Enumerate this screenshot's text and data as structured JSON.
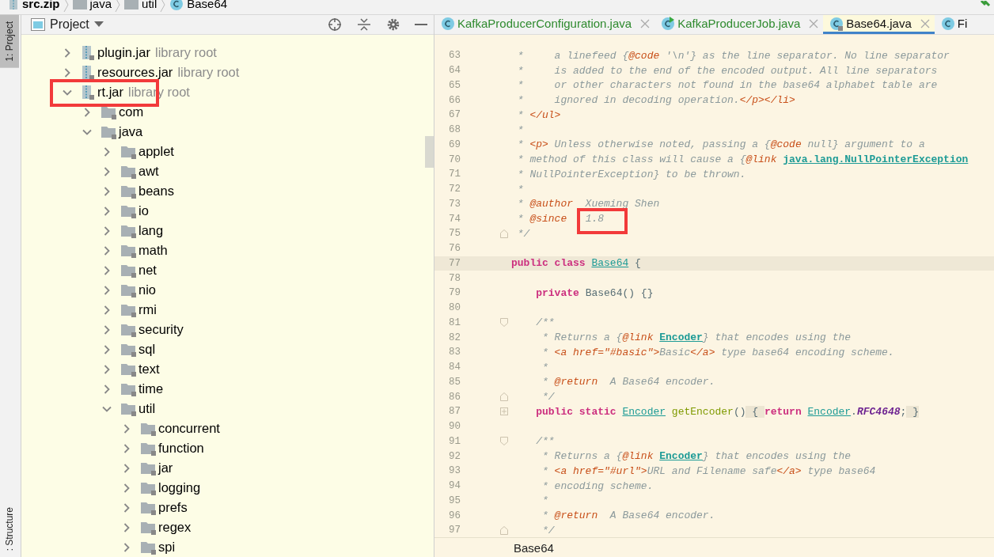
{
  "breadcrumb": [
    {
      "kind": "zip",
      "label": "src.zip"
    },
    {
      "kind": "folder",
      "label": "java"
    },
    {
      "kind": "folder",
      "label": "util"
    },
    {
      "kind": "class",
      "label": "Base64"
    }
  ],
  "left_strip": {
    "top": [
      {
        "label": "1: Project",
        "selected": true
      }
    ],
    "bottom": [
      {
        "label": ": Structure",
        "selected": false
      }
    ]
  },
  "project_panel": {
    "title": "Project",
    "tree": [
      {
        "kind": "jar",
        "label": "plugin.jar",
        "hint": "library root",
        "expanded": false,
        "highlighted": false
      },
      {
        "kind": "jar",
        "label": "resources.jar",
        "hint": "library root",
        "expanded": false,
        "highlighted": false
      },
      {
        "kind": "jar",
        "label": "rt.jar",
        "hint": "library root",
        "expanded": true,
        "highlighted": true,
        "children": [
          {
            "kind": "package",
            "label": "com",
            "expanded": false,
            "highlighted": false
          },
          {
            "kind": "package",
            "label": "java",
            "expanded": true,
            "highlighted": false,
            "children": [
              {
                "kind": "package",
                "label": "applet",
                "expanded": false,
                "highlighted": false
              },
              {
                "kind": "package",
                "label": "awt",
                "expanded": false,
                "highlighted": false
              },
              {
                "kind": "package",
                "label": "beans",
                "expanded": false,
                "highlighted": false
              },
              {
                "kind": "package",
                "label": "io",
                "expanded": false,
                "highlighted": false
              },
              {
                "kind": "package",
                "label": "lang",
                "expanded": false,
                "highlighted": false
              },
              {
                "kind": "package",
                "label": "math",
                "expanded": false,
                "highlighted": false
              },
              {
                "kind": "package",
                "label": "net",
                "expanded": false,
                "highlighted": false
              },
              {
                "kind": "package",
                "label": "nio",
                "expanded": false,
                "highlighted": false
              },
              {
                "kind": "package",
                "label": "rmi",
                "expanded": false,
                "highlighted": false
              },
              {
                "kind": "package",
                "label": "security",
                "expanded": false,
                "highlighted": false
              },
              {
                "kind": "package",
                "label": "sql",
                "expanded": false,
                "highlighted": false
              },
              {
                "kind": "package",
                "label": "text",
                "expanded": false,
                "highlighted": false
              },
              {
                "kind": "package",
                "label": "time",
                "expanded": false,
                "highlighted": false
              },
              {
                "kind": "package",
                "label": "util",
                "expanded": true,
                "highlighted": false,
                "children": [
                  {
                    "kind": "package",
                    "label": "concurrent",
                    "expanded": false,
                    "highlighted": false
                  },
                  {
                    "kind": "package",
                    "label": "function",
                    "expanded": false,
                    "highlighted": false
                  },
                  {
                    "kind": "package",
                    "label": "jar",
                    "expanded": false,
                    "highlighted": false
                  },
                  {
                    "kind": "package",
                    "label": "logging",
                    "expanded": false,
                    "highlighted": false
                  },
                  {
                    "kind": "package",
                    "label": "prefs",
                    "expanded": false,
                    "highlighted": false
                  },
                  {
                    "kind": "package",
                    "label": "regex",
                    "expanded": false,
                    "highlighted": false
                  },
                  {
                    "kind": "package",
                    "label": "spi",
                    "expanded": false,
                    "highlighted": false
                  }
                ]
              }
            ]
          }
        ]
      }
    ]
  },
  "tabs": [
    {
      "label": "KafkaProducerConfiguration.java",
      "kind": "class",
      "color": "#2f8a2f",
      "selected": false
    },
    {
      "label": "KafkaProducerJob.java",
      "kind": "runnable",
      "color": "#2f8a2f",
      "selected": false
    },
    {
      "label": "Base64.java",
      "kind": "locked",
      "color": "#111111",
      "selected": true
    },
    {
      "label": "Fi",
      "kind": "class",
      "color": "#111111",
      "selected": false
    }
  ],
  "editor": {
    "lines": [
      {
        "no": "63",
        "kind": "plain",
        "tokens": [
          {
            "kind": "comment",
            "text": " *     a linefeed {"
          },
          {
            "kind": "tag",
            "text": "@code"
          },
          {
            "kind": "comment",
            "text": " '\\n'} as the line separator. No line separator"
          }
        ]
      },
      {
        "no": "64",
        "kind": "plain",
        "tokens": [
          {
            "kind": "comment",
            "text": " *     is added to the end of the encoded output. All line separators"
          }
        ]
      },
      {
        "no": "65",
        "kind": "plain",
        "tokens": [
          {
            "kind": "comment",
            "text": " *     or other characters not found in the base64 alphabet table are"
          }
        ]
      },
      {
        "no": "66",
        "kind": "plain",
        "tokens": [
          {
            "kind": "comment",
            "text": " *     ignored in decoding operation."
          },
          {
            "kind": "tag",
            "text": "</p></li>"
          }
        ]
      },
      {
        "no": "67",
        "kind": "plain",
        "tokens": [
          {
            "kind": "comment",
            "text": " * "
          },
          {
            "kind": "tag",
            "text": "</ul>"
          }
        ]
      },
      {
        "no": "68",
        "kind": "plain",
        "tokens": [
          {
            "kind": "comment",
            "text": " *"
          }
        ]
      },
      {
        "no": "69",
        "kind": "plain",
        "tokens": [
          {
            "kind": "comment",
            "text": " * "
          },
          {
            "kind": "tag",
            "text": "<p>"
          },
          {
            "kind": "comment",
            "text": " Unless otherwise noted, passing a {"
          },
          {
            "kind": "tag",
            "text": "@code"
          },
          {
            "kind": "comment",
            "text": " null} argument to a"
          }
        ]
      },
      {
        "no": "70",
        "kind": "plain",
        "tokens": [
          {
            "kind": "comment",
            "text": " * method of this class will cause a {"
          },
          {
            "kind": "tag",
            "text": "@link "
          },
          {
            "kind": "link",
            "text": "java.lang.NullPointerException"
          }
        ]
      },
      {
        "no": "71",
        "kind": "plain",
        "tokens": [
          {
            "kind": "comment",
            "text": " * NullPointerException} to be thrown."
          }
        ]
      },
      {
        "no": "72",
        "kind": "plain",
        "tokens": [
          {
            "kind": "comment",
            "text": " *"
          }
        ]
      },
      {
        "no": "73",
        "kind": "plain",
        "tokens": [
          {
            "kind": "comment",
            "text": " * "
          },
          {
            "kind": "tag",
            "text": "@author"
          },
          {
            "kind": "comment",
            "text": "  Xueming Shen"
          }
        ]
      },
      {
        "no": "74",
        "kind": "plain",
        "tokens": [
          {
            "kind": "comment",
            "text": " * "
          },
          {
            "kind": "tag",
            "text": "@since   "
          },
          {
            "kind": "comment",
            "text": "1.8",
            "annotated": true
          }
        ]
      },
      {
        "no": "75",
        "kind": "fold-end",
        "tokens": [
          {
            "kind": "comment",
            "text": " */"
          }
        ]
      },
      {
        "no": "76",
        "kind": "plain"
      },
      {
        "no": "77",
        "kind": "plain",
        "current": true,
        "tokens": [
          {
            "kind": "keyword",
            "text": "public class "
          },
          {
            "kind": "type",
            "text": "Base64"
          },
          {
            "kind": "plain",
            "text": " {"
          }
        ]
      },
      {
        "no": "78",
        "kind": "plain"
      },
      {
        "no": "79",
        "kind": "plain",
        "tokens": [
          {
            "kind": "keyword",
            "text": "    private "
          },
          {
            "kind": "plain",
            "text": "Base64() {}"
          }
        ]
      },
      {
        "no": "80",
        "kind": "plain"
      },
      {
        "no": "81",
        "kind": "fold-start",
        "tokens": [
          {
            "kind": "comment",
            "text": "    /**"
          }
        ]
      },
      {
        "no": "82",
        "kind": "plain",
        "tokens": [
          {
            "kind": "comment",
            "text": "     * Returns a {"
          },
          {
            "kind": "tag",
            "text": "@link "
          },
          {
            "kind": "link",
            "text": "Encoder"
          },
          {
            "kind": "comment",
            "text": "} that encodes using the"
          }
        ]
      },
      {
        "no": "83",
        "kind": "plain",
        "tokens": [
          {
            "kind": "comment",
            "text": "     * "
          },
          {
            "kind": "tag",
            "text": "<a href=\"#basic\">"
          },
          {
            "kind": "comment",
            "text": "Basic"
          },
          {
            "kind": "tag",
            "text": "</a>"
          },
          {
            "kind": "comment",
            "text": " type base64 encoding scheme."
          }
        ]
      },
      {
        "no": "84",
        "kind": "plain",
        "tokens": [
          {
            "kind": "comment",
            "text": "     *"
          }
        ]
      },
      {
        "no": "85",
        "kind": "plain",
        "tokens": [
          {
            "kind": "comment",
            "text": "     * "
          },
          {
            "kind": "tag",
            "text": "@return"
          },
          {
            "kind": "comment",
            "text": "  A Base64 encoder."
          }
        ]
      },
      {
        "no": "86",
        "kind": "fold-end",
        "tokens": [
          {
            "kind": "comment",
            "text": "     */"
          }
        ]
      },
      {
        "no": "87",
        "kind": "folded",
        "tokens": [
          {
            "kind": "keyword",
            "text": "    public static "
          },
          {
            "kind": "type",
            "text": "Encoder"
          },
          {
            "kind": "method",
            "text": " getEncoder"
          },
          {
            "kind": "plain",
            "text": "()"
          },
          {
            "kind": "folded",
            "text": " { "
          },
          {
            "kind": "keyword",
            "text": "return "
          },
          {
            "kind": "type",
            "text": "Encoder"
          },
          {
            "kind": "plain",
            "text": "."
          },
          {
            "kind": "field",
            "text": "RFC4648"
          },
          {
            "kind": "plain",
            "text": ";"
          },
          {
            "kind": "folded",
            "text": " }"
          }
        ]
      },
      {
        "no": "90",
        "kind": "plain"
      },
      {
        "no": "91",
        "kind": "fold-start",
        "tokens": [
          {
            "kind": "comment",
            "text": "    /**"
          }
        ]
      },
      {
        "no": "92",
        "kind": "plain",
        "tokens": [
          {
            "kind": "comment",
            "text": "     * Returns a {"
          },
          {
            "kind": "tag",
            "text": "@link "
          },
          {
            "kind": "link",
            "text": "Encoder"
          },
          {
            "kind": "comment",
            "text": "} that encodes using the"
          }
        ]
      },
      {
        "no": "93",
        "kind": "plain",
        "tokens": [
          {
            "kind": "comment",
            "text": "     * "
          },
          {
            "kind": "tag",
            "text": "<a href=\"#url\">"
          },
          {
            "kind": "comment",
            "text": "URL and Filename safe"
          },
          {
            "kind": "tag",
            "text": "</a>"
          },
          {
            "kind": "comment",
            "text": " type base64"
          }
        ]
      },
      {
        "no": "94",
        "kind": "plain",
        "tokens": [
          {
            "kind": "comment",
            "text": "     * encoding scheme."
          }
        ]
      },
      {
        "no": "95",
        "kind": "plain",
        "tokens": [
          {
            "kind": "comment",
            "text": "     *"
          }
        ]
      },
      {
        "no": "96",
        "kind": "plain",
        "tokens": [
          {
            "kind": "comment",
            "text": "     * "
          },
          {
            "kind": "tag",
            "text": "@return"
          },
          {
            "kind": "comment",
            "text": "  A Base64 encoder."
          }
        ]
      },
      {
        "no": "97",
        "kind": "fold-end",
        "tokens": [
          {
            "kind": "comment",
            "text": "     */"
          }
        ]
      }
    ],
    "breadcrumb": "Base64"
  }
}
